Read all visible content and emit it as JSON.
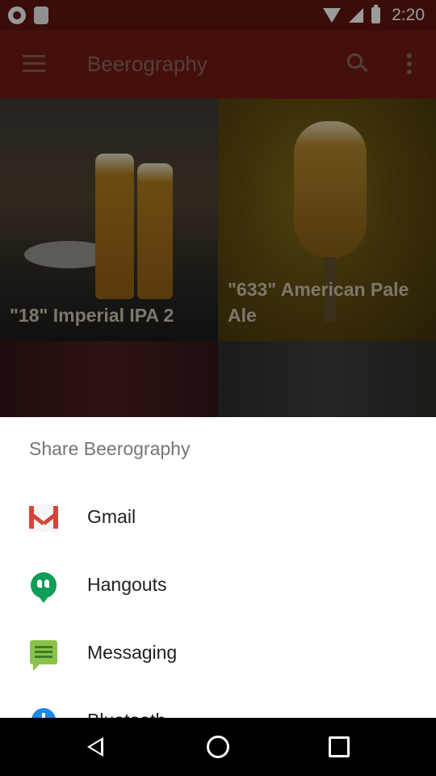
{
  "status_bar": {
    "time": "2:20"
  },
  "app_bar": {
    "title": "Beerography"
  },
  "grid": {
    "tiles": [
      {
        "caption": "\"18\" Imperial IPA 2"
      },
      {
        "caption": "\"633\" American Pale Ale"
      },
      {
        "caption": ""
      },
      {
        "caption": ""
      }
    ]
  },
  "share_sheet": {
    "title": "Share Beerography",
    "items": [
      {
        "label": "Gmail",
        "icon": "gmail-icon"
      },
      {
        "label": "Hangouts",
        "icon": "hangouts-icon"
      },
      {
        "label": "Messaging",
        "icon": "messaging-icon"
      },
      {
        "label": "Bluetooth",
        "icon": "bluetooth-icon"
      }
    ]
  },
  "colors": {
    "status_bar": "#5a1510",
    "app_bar": "#6b1a12",
    "sheet_background": "#ffffff",
    "gmail_red": "#d44638",
    "hangouts_green": "#0f9d58",
    "messaging_green": "#8bc34a",
    "bluetooth_blue": "#1e88e5"
  }
}
